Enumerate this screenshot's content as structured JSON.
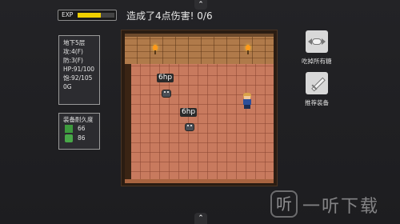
{
  "exp": {
    "label": "EXP",
    "progress": 0.62
  },
  "message": "造成了4点伤害! 0/6",
  "stats": {
    "floor": "地下5层",
    "attack": "攻:4(F)",
    "defense": "防:3(F)",
    "hp": "HP:91/100",
    "hunger": "饱:92/105",
    "gold": "0G"
  },
  "durability": {
    "title": "装备耐久度",
    "weapon": {
      "icon": "sword-icon",
      "value": "66"
    },
    "armor": {
      "icon": "armor-icon",
      "value": "86"
    }
  },
  "monsters": [
    {
      "hp": "6hp"
    },
    {
      "hp": "6hp"
    }
  ],
  "buttons": {
    "eat_all_candy": {
      "label": "吃掉所有糖",
      "icon": "candy-icon"
    },
    "recommend_equip": {
      "label": "推荐装备",
      "icon": "sword-icon"
    }
  },
  "nav": {
    "top_chevron": "⌃",
    "bottom_chevron": "⌃"
  },
  "watermark": {
    "icon": "听",
    "text": "一听下载"
  },
  "colors": {
    "exp_fill": "#f0d000",
    "armor_green": "#48a848",
    "floor": "#c87a5e"
  }
}
